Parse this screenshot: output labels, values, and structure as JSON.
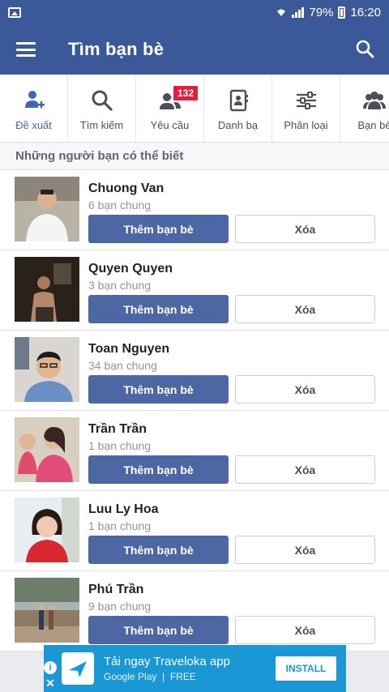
{
  "status_bar": {
    "battery": "79%",
    "time": "16:20"
  },
  "header": {
    "title": "Tìm bạn bè"
  },
  "tabs": [
    {
      "label": "Đề xuất",
      "icon": "add-person-icon",
      "active": true
    },
    {
      "label": "Tìm kiếm",
      "icon": "search-icon",
      "active": false
    },
    {
      "label": "Yêu cầu",
      "icon": "friend-requests-icon",
      "active": false,
      "badge": "132"
    },
    {
      "label": "Danh bạ",
      "icon": "contacts-book-icon",
      "active": false
    },
    {
      "label": "Phân loại",
      "icon": "sliders-icon",
      "active": false
    },
    {
      "label": "Bạn bè",
      "icon": "friends-icon",
      "active": false
    }
  ],
  "section": {
    "title": "Những người bạn có thể biết"
  },
  "people": [
    {
      "name": "Chuong Van",
      "mutual": "6 bạn chung",
      "add_label": "Thêm bạn bè",
      "delete_label": "Xóa"
    },
    {
      "name": "Quyen Quyen",
      "mutual": "3 bạn chung",
      "add_label": "Thêm bạn bè",
      "delete_label": "Xóa"
    },
    {
      "name": "Toan Nguyen",
      "mutual": "34 bạn chung",
      "add_label": "Thêm bạn bè",
      "delete_label": "Xóa"
    },
    {
      "name": "Trần Trần",
      "mutual": "1 bạn chung",
      "add_label": "Thêm bạn bè",
      "delete_label": "Xóa"
    },
    {
      "name": "Luu Ly Hoa",
      "mutual": "1 bạn chung",
      "add_label": "Thêm bạn bè",
      "delete_label": "Xóa"
    },
    {
      "name": "Phú Trần",
      "mutual": "9 bạn chung",
      "add_label": "Thêm bạn bè",
      "delete_label": "Xóa"
    }
  ],
  "ad": {
    "title": "Tải ngay Traveloka app",
    "store": "Google Play",
    "price": "FREE",
    "install_label": "INSTALL"
  },
  "colors": {
    "brand": "#3b5998",
    "button": "#4d67a4",
    "badge": "#e41e3f",
    "ad": "#1a98d5"
  }
}
